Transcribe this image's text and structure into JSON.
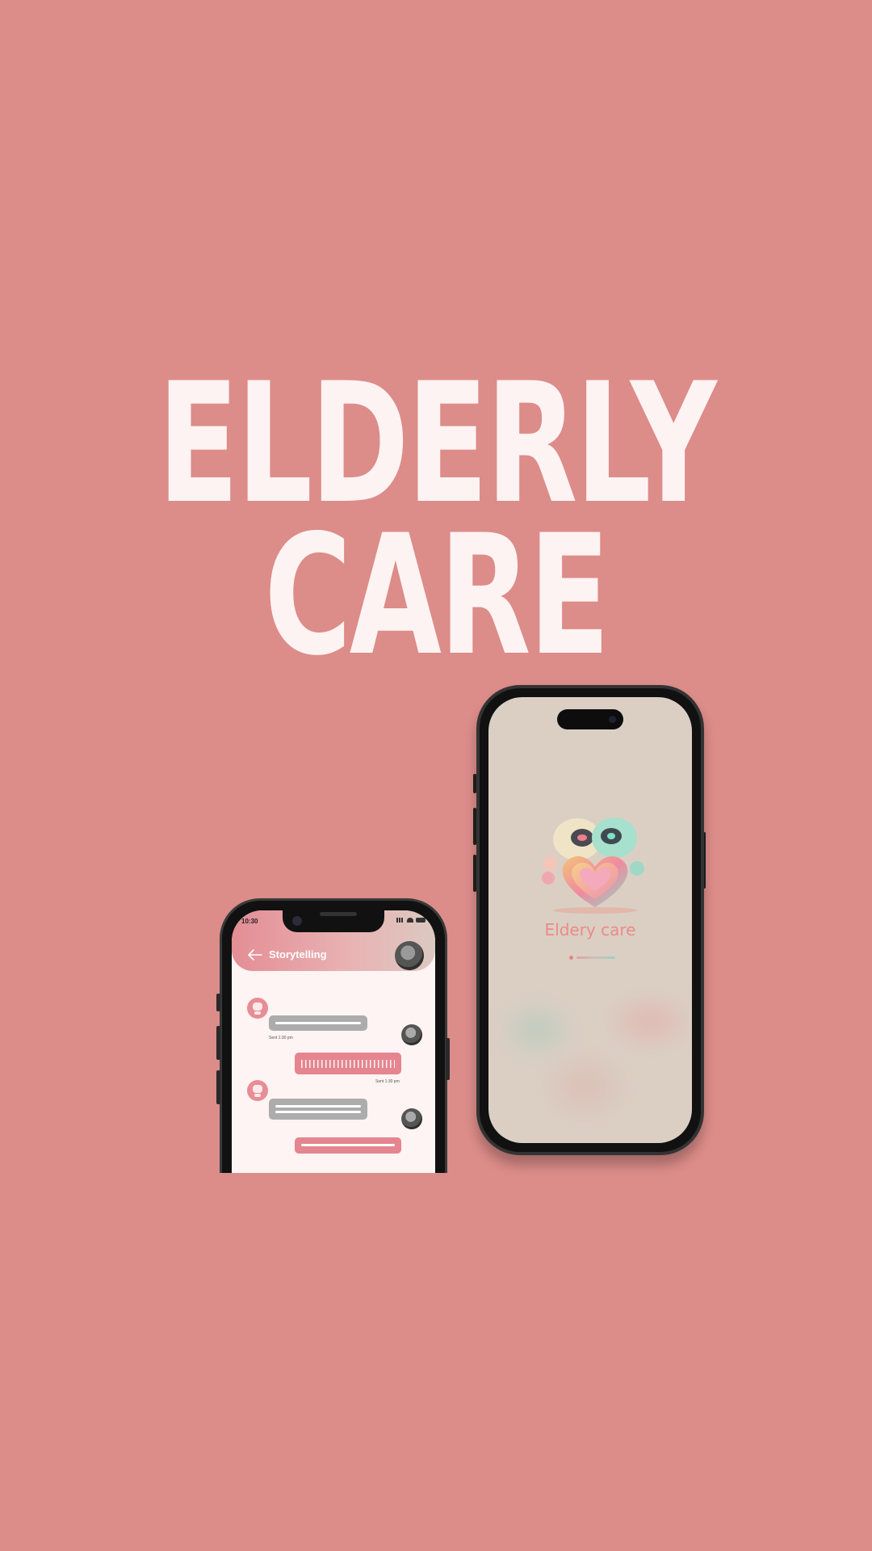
{
  "headline": {
    "line1": "ELDERLY",
    "line2": "CARE"
  },
  "chat_phone": {
    "status_time": "10:30",
    "header_title": "Storytelling",
    "messages": [
      {
        "from": "bot",
        "kind": "text"
      },
      {
        "from": "user",
        "kind": "voice",
        "sent": "Sent 1:30 pm"
      },
      {
        "from": "bot",
        "kind": "text"
      },
      {
        "from": "user",
        "kind": "text"
      }
    ],
    "sent_labels": {
      "first": "Sent 1:30 pm",
      "second": "Sent 1:30 pm"
    }
  },
  "splash_phone": {
    "app_name": "Eldery care",
    "loading_progress": 0.2
  },
  "colors": {
    "background": "#dc8c89",
    "headline": "#fdf3f2",
    "accent_pink": "#e5858f",
    "splash_bg": "#dbcfc4",
    "app_name": "#ec8a88"
  },
  "icons": [
    "back-arrow-icon",
    "signal-icon",
    "wifi-icon",
    "battery-icon",
    "heart-robots-mascot"
  ]
}
